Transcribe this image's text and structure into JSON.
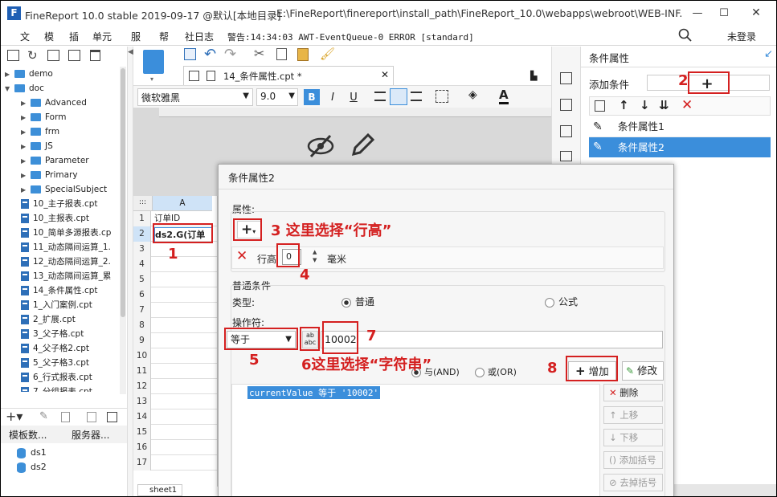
{
  "window": {
    "app_title": "FineReport 10.0 stable 2019-09-17 @默认[本地目录]",
    "path": "E:\\FineReport\\finereport\\install_path\\FineReport_10.0\\webapps\\webroot\\WEB-INF...",
    "min_label": "—",
    "max_label": "☐",
    "close_label": "✕"
  },
  "menubar": {
    "items": [
      "文",
      "模",
      "插",
      "单元",
      "服",
      "帮",
      "社日志"
    ],
    "alert": "警告:14:34:03 AWT-EventQueue-0 ERROR [standard]",
    "login": "未登录"
  },
  "left_tree": {
    "items": [
      {
        "type": "folder",
        "label": "demo",
        "indent": 0
      },
      {
        "type": "folder",
        "label": "doc",
        "indent": 0
      },
      {
        "type": "folder",
        "label": "Advanced",
        "indent": 1
      },
      {
        "type": "folder",
        "label": "Form",
        "indent": 1
      },
      {
        "type": "folder",
        "label": "frm",
        "indent": 1
      },
      {
        "type": "folder",
        "label": "JS",
        "indent": 1
      },
      {
        "type": "folder",
        "label": "Parameter",
        "indent": 1
      },
      {
        "type": "folder",
        "label": "Primary",
        "indent": 1
      },
      {
        "type": "folder",
        "label": "SpecialSubject",
        "indent": 1
      },
      {
        "type": "file",
        "label": "10_主子报表.cpt",
        "indent": 1
      },
      {
        "type": "file",
        "label": "10_主报表.cpt",
        "indent": 1
      },
      {
        "type": "file",
        "label": "10_简单多源报表.cp",
        "indent": 1
      },
      {
        "type": "file",
        "label": "11_动态隔间运算_1.",
        "indent": 1
      },
      {
        "type": "file",
        "label": "12_动态隔间运算_2.",
        "indent": 1
      },
      {
        "type": "file",
        "label": "13_动态隔间运算_累",
        "indent": 1
      },
      {
        "type": "file",
        "label": "14_条件属性.cpt",
        "indent": 1
      },
      {
        "type": "file",
        "label": "1_入门案例.cpt",
        "indent": 1
      },
      {
        "type": "file",
        "label": "2_扩展.cpt",
        "indent": 1
      },
      {
        "type": "file",
        "label": "3_父子格.cpt",
        "indent": 1
      },
      {
        "type": "file",
        "label": "4_父子格2.cpt",
        "indent": 1
      },
      {
        "type": "file",
        "label": "5_父子格3.cpt",
        "indent": 1
      },
      {
        "type": "file",
        "label": "6_行式报表.cpt",
        "indent": 1
      }
    ],
    "cut_item": "7_分组报表.cpt",
    "tab_template": "模板数...",
    "tab_server": "服务器...",
    "datasets": [
      "ds1",
      "ds2"
    ]
  },
  "editor": {
    "tab_label": "14_条件属性.cpt *",
    "font_name": "微软雅黑",
    "font_size": "9.0",
    "bold": "B",
    "italic": "I",
    "underline": "U",
    "col_a": "A",
    "cell_a1": "订单ID",
    "cell_a2": "ds2.G(订单",
    "rows": [
      "1",
      "2",
      "3",
      "4",
      "5",
      "6",
      "7",
      "8",
      "9",
      "10",
      "11",
      "12",
      "13",
      "14",
      "15",
      "16",
      "17"
    ],
    "sheet_tab": "sheet1"
  },
  "right_panel": {
    "title": "条件属性",
    "add_condition_label": "添加条件",
    "plus": "+",
    "items": [
      "条件属性1",
      "条件属性2"
    ]
  },
  "dialog": {
    "title": "条件属性2",
    "attr_section": "属性:",
    "plus_dropdown": "+",
    "row_height_label": "行高",
    "row_height_value": "0",
    "unit_label": "毫米",
    "normal_condition_section": "普通条件",
    "type_label": "类型:",
    "type_normal": "普通",
    "type_formula": "公式",
    "operator_label": "操作符:",
    "operator_value": "等于",
    "value_text": "10002",
    "and_label": "与(AND)",
    "or_label": "或(OR)",
    "add_button": "增加",
    "modify_button": "修改",
    "condition_line": "currentValue 等于 '10002'",
    "delete_button": "删除",
    "move_up_button": "上移",
    "move_down_button": "下移",
    "add_paren_button": "添加括号",
    "remove_paren_button": "去掉括号"
  },
  "annotations": {
    "a1": "1",
    "a2": "2",
    "a3": "3 这里选择“行高”",
    "a4": "4",
    "a5": "5",
    "a6": "6这里选择“字符串”",
    "a7": "7",
    "a8": "8"
  },
  "colors": {
    "annotation_red": "#d42020",
    "selection_blue": "#3b8edb",
    "folder_blue": "#3d8fd8"
  }
}
